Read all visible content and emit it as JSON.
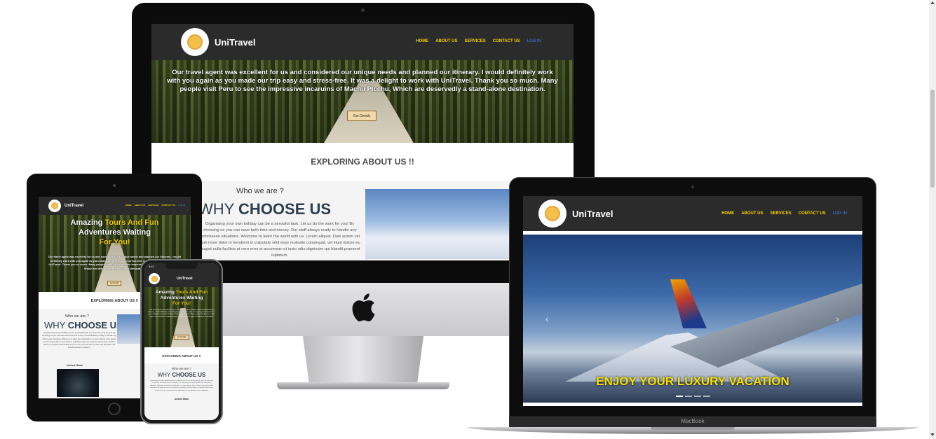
{
  "brand": {
    "name": "UniTravel"
  },
  "nav": {
    "items": [
      "HOME",
      "ABOUT US",
      "SERVICES",
      "CONTACT US"
    ],
    "login": "LOG IN"
  },
  "hero": {
    "text": "Our travel agent was excellent for us and considered our unique needs and planned our itinerary. I would definitely work with you again as you made our trip easy and stress-free. It was a delight to work with UniTravel. Thank you so much. Many people visit Peru to see the impressive incaruins of Machu Picchu, Which are deservedly a stand-alone destination.",
    "button": "Get Details",
    "title_part1": "Amazing ",
    "title_highlight1": "Tours And Fun",
    "title_part2": "Adventures Waiting",
    "title_highlight2": "For You!"
  },
  "explore": {
    "title": "EXPLORING ABOUT US !!"
  },
  "about": {
    "who": "Who we are ?",
    "why_light": "WHY ",
    "why_bold": "CHOOSE US",
    "paragraph": "Organising your own holiday can be a stressful task. Let us do the work for you! By choosing us you can save both time and money. Our staff always ready to handle any unforeseen situations. Welcome to learn the world with us. Lorem aliquat. Duis autem vel eum iriure dolor in hendrerit in vulputate velit esse molestie consequat, vel illum dolore eu feugiat nulla facilisis at vero eros et accumsan et iusto odio dignissim qui blandit praesent luptatum.",
    "state": "United State"
  },
  "laptop": {
    "caption": "ENJOY YOUR LUXURY VACATION",
    "prev": "‹",
    "next": "›",
    "label": "MacBook"
  },
  "phone": {
    "time": "9:41"
  },
  "colors": {
    "header": "#2b2b2b",
    "nav": "#f5d000",
    "login": "#3b82f6",
    "caption": "#f5e000",
    "heading": "#2c3e50"
  }
}
